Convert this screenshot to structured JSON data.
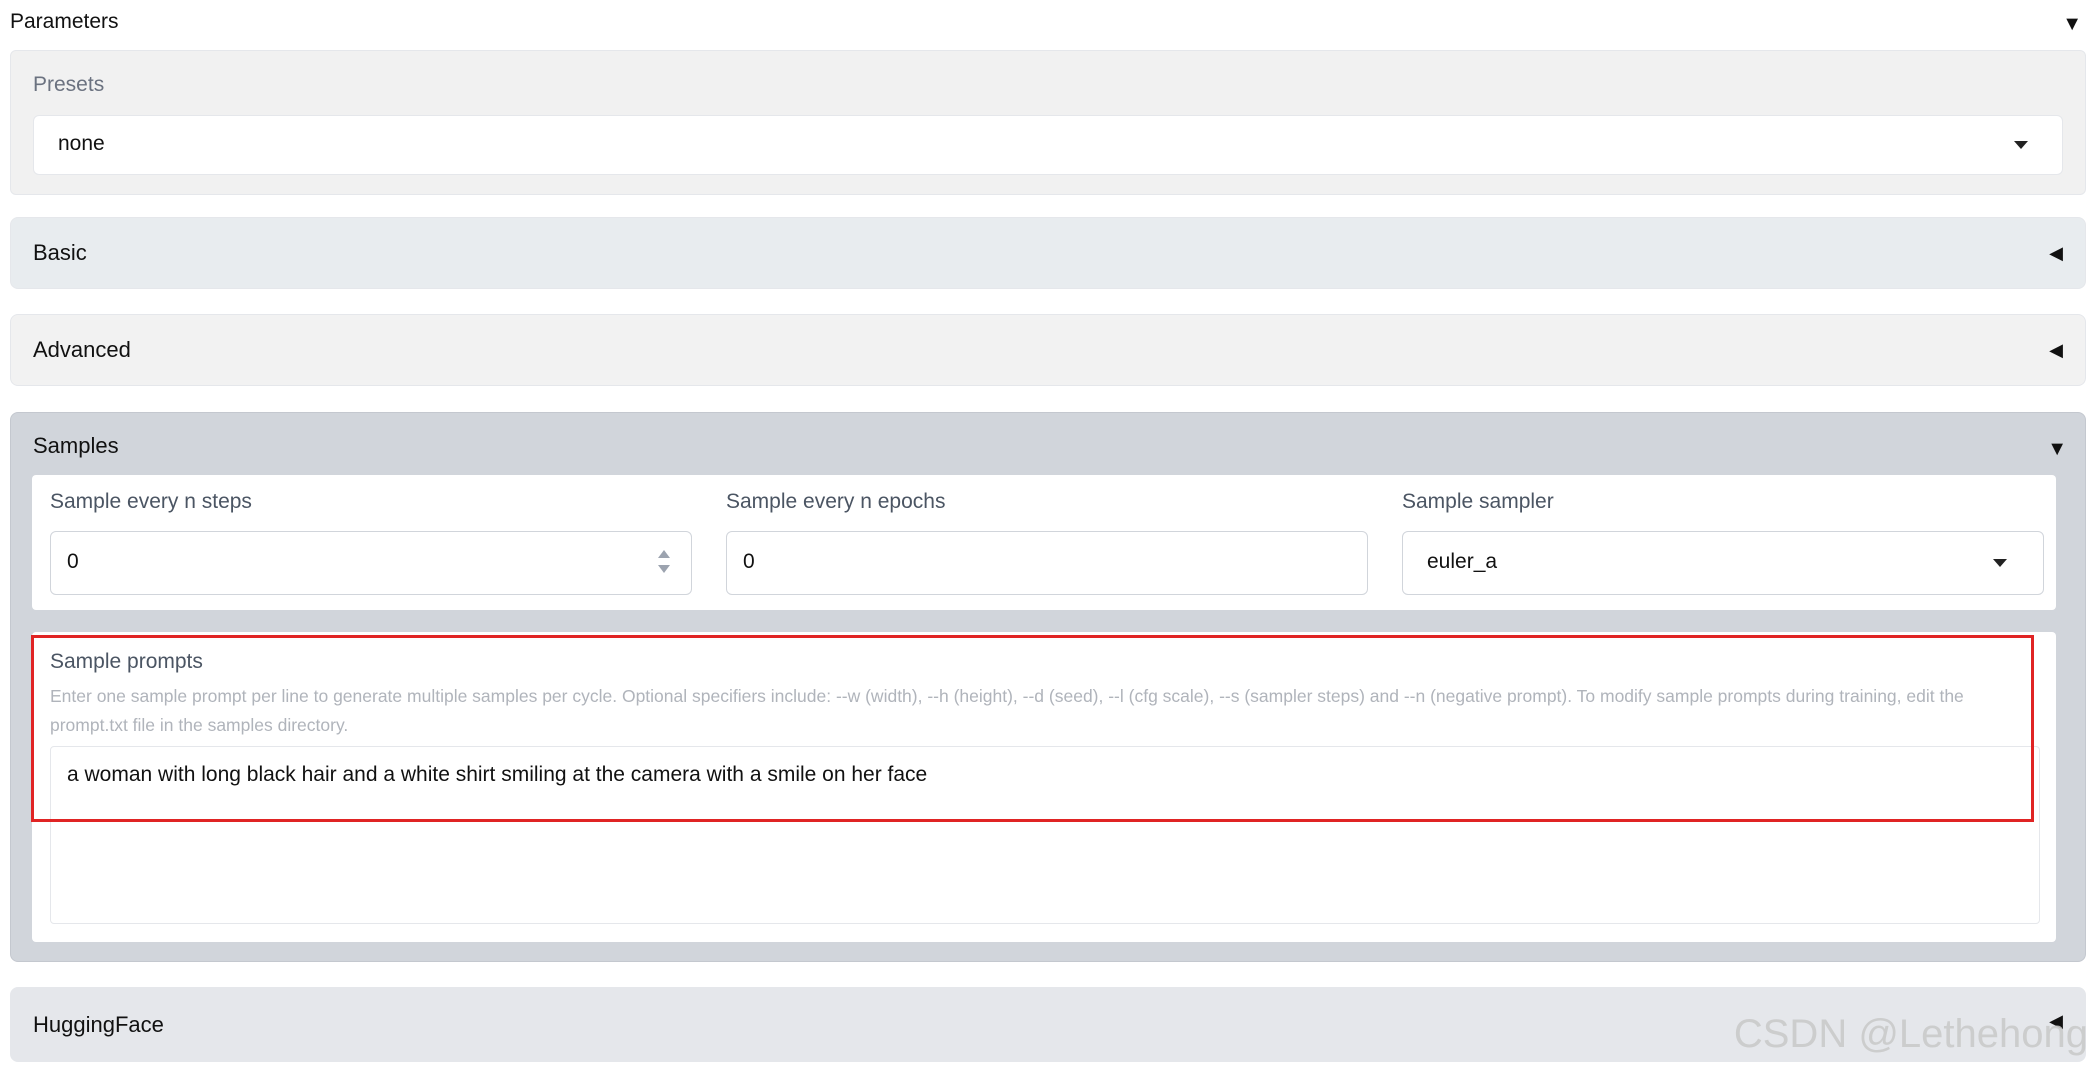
{
  "parameters": {
    "title": "Parameters"
  },
  "presets": {
    "label": "Presets",
    "value": "none"
  },
  "sections": {
    "basic": "Basic",
    "advanced": "Advanced",
    "samples": "Samples",
    "huggingface": "HuggingFace"
  },
  "samples": {
    "steps": {
      "label": "Sample every n steps",
      "value": "0"
    },
    "epochs": {
      "label": "Sample every n epochs",
      "value": "0"
    },
    "sampler": {
      "label": "Sample sampler",
      "value": "euler_a"
    },
    "prompts": {
      "label": "Sample prompts",
      "help": "Enter one sample prompt per line to generate multiple samples per cycle. Optional specifiers include: --w (width), --h (height), --d (seed), --l (cfg scale), --s (sampler steps) and --n (negative prompt). To modify sample prompts during training, edit the prompt.txt file in the samples directory.",
      "value": "a woman with long black hair and a white shirt smiling at the camera with a smile on her face"
    }
  },
  "watermark": "CSDN @Lethehong",
  "colors": {
    "highlight": "#e02424",
    "samples_bg": "#d1d5db"
  }
}
